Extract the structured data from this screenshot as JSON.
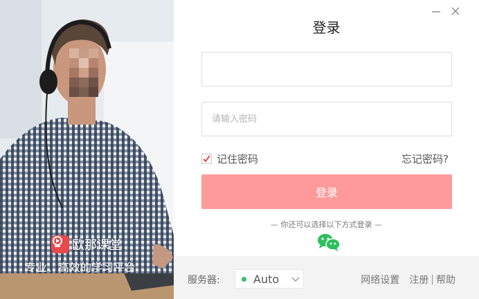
{
  "brand": {
    "name": "欧那课堂",
    "slogan": "专业、高效的学习平台",
    "color": "#e84a4a"
  },
  "window": {
    "minimize_icon": "minimize-icon",
    "close_icon": "close-icon"
  },
  "login": {
    "title": "登录",
    "username_placeholder": "",
    "password_placeholder": "请输入密码",
    "remember_label": "记住密码",
    "remember_checked": true,
    "forgot_label": "忘记密码?",
    "submit_label": "登录",
    "alt_text": "— 你还可以选择以下方式登录 —",
    "alt_icon": "wechat-icon",
    "accent_color": "#ff9a9a"
  },
  "footer": {
    "server_label": "服务器:",
    "server_value": "Auto",
    "server_status_color": "#3bbf6a",
    "network_label": "网络设置",
    "register_label": "注册",
    "separator": "|",
    "help_label": "帮助"
  }
}
